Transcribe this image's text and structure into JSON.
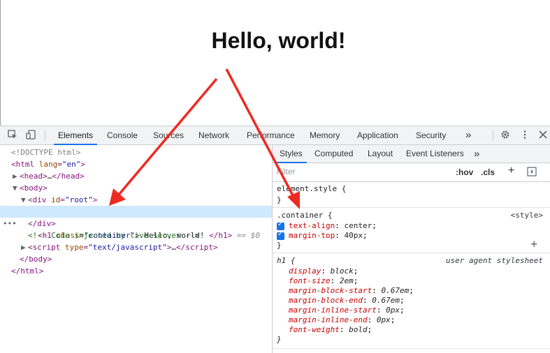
{
  "page": {
    "heading": "Hello, world!"
  },
  "devtools": {
    "tabs": [
      "Elements",
      "Console",
      "Sources",
      "Network",
      "Performance",
      "Memory",
      "Application",
      "Security"
    ],
    "more_tabs": "»",
    "active_tab": "Elements"
  },
  "elements": {
    "lines": {
      "doctype": "<!DOCTYPE html>",
      "html_open_tag": "html",
      "html_attr_name": "lang",
      "html_attr_val": "\"en\"",
      "head_tag": "head",
      "head_ellipsis": "…",
      "body_tag": "body",
      "div_tag": "div",
      "div_attr_name": "id",
      "div_attr_val": "\"root\"",
      "h1_tag": "h1",
      "h1_attr_name": "class",
      "h1_attr_val": "\"container\"",
      "h1_text": " Hello, world! ",
      "h1_suffix": " == $0",
      "comment": "<!-- Code injected by live-server -->",
      "script_tag": "script",
      "script_attr_name": "type",
      "script_attr_val": "\"text/javascript\"",
      "script_ellipsis": "…"
    }
  },
  "styles": {
    "tabs": [
      "Styles",
      "Computed",
      "Layout",
      "Event Listeners"
    ],
    "more_tabs": "»",
    "filter_placeholder": "Filter",
    "hov": ":hov",
    "cls": ".cls",
    "rules": {
      "element_style": "element.style {",
      "container_selector": ".container",
      "container_source": "<style>",
      "container_props": [
        {
          "name": "text-align",
          "value": "center"
        },
        {
          "name": "margin-top",
          "value": "40px"
        }
      ],
      "ua_selector": "h1",
      "ua_source": "user agent stylesheet",
      "ua_props": [
        {
          "name": "display",
          "value": "block"
        },
        {
          "name": "font-size",
          "value": "2em"
        },
        {
          "name": "margin-block-start",
          "value": "0.67em"
        },
        {
          "name": "margin-block-end",
          "value": "0.67em"
        },
        {
          "name": "margin-inline-start",
          "value": "0px"
        },
        {
          "name": "margin-inline-end",
          "value": "0px"
        },
        {
          "name": "font-weight",
          "value": "bold"
        }
      ]
    }
  },
  "annotation": {
    "arrow_color": "#ee2b22"
  },
  "colors": {
    "accent": "#1a73e8",
    "selected_row": "#cfe8fc"
  }
}
